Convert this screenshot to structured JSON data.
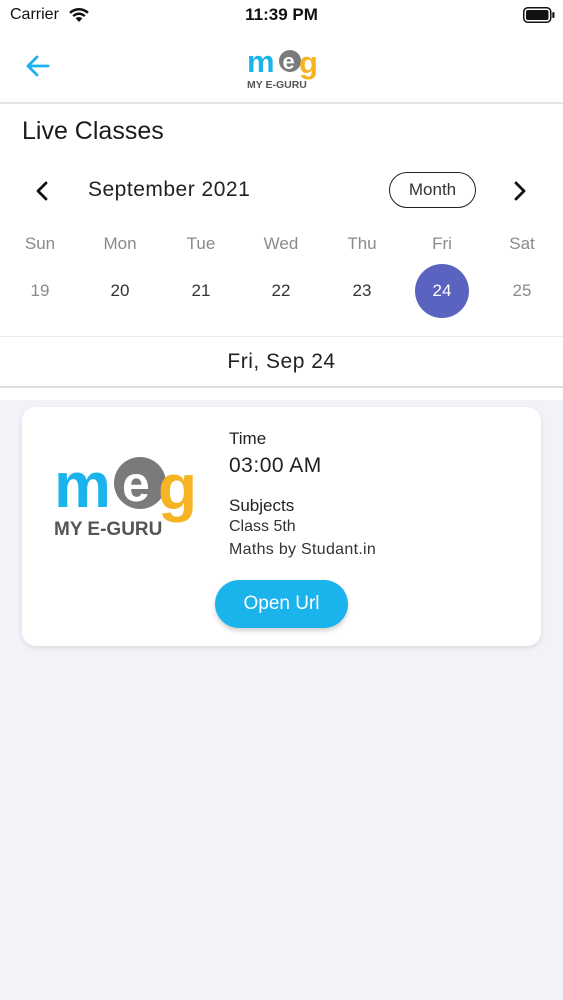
{
  "status_bar": {
    "carrier": "Carrier",
    "time": "11:39 PM"
  },
  "nav": {
    "logo_text": "meg",
    "logo_sub": "MY E-GURU"
  },
  "page_title": "Live Classes",
  "calendar": {
    "month_label": "September 2021",
    "view_toggle": "Month",
    "days": [
      {
        "name": "Sun",
        "number": "19"
      },
      {
        "name": "Mon",
        "number": "20"
      },
      {
        "name": "Tue",
        "number": "21"
      },
      {
        "name": "Wed",
        "number": "22"
      },
      {
        "name": "Thu",
        "number": "23"
      },
      {
        "name": "Fri",
        "number": "24"
      },
      {
        "name": "Sat",
        "number": "25"
      }
    ],
    "selected_date": "Fri, Sep 24"
  },
  "class_card": {
    "time_heading": "Time",
    "time_value": "03:00 AM",
    "subjects_heading": "Subjects",
    "class_line": "Class 5th",
    "subject_line": "Maths by Studant.in",
    "open_url_label": "Open Url"
  },
  "colors": {
    "accent_blue": "#1ab3ec",
    "selected_day": "#5b63c1",
    "logo_yellow": "#f6b323",
    "logo_gray": "#7a7a7a"
  }
}
